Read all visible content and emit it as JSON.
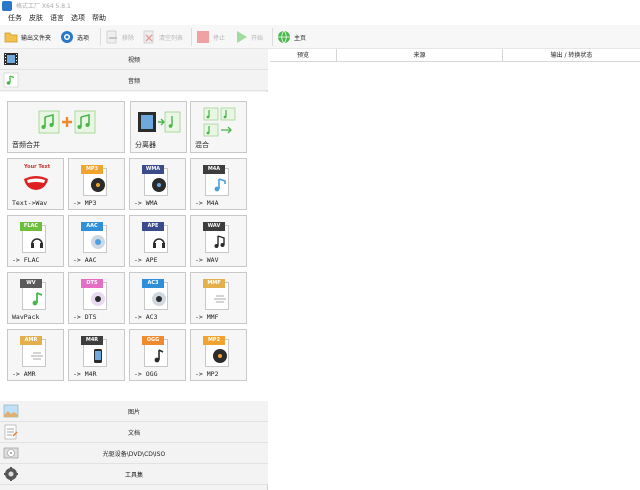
{
  "window": {
    "title": "格式工厂 X64 5.8.1"
  },
  "menu": {
    "items": [
      "任务",
      "皮肤",
      "语言",
      "选项",
      "帮助"
    ]
  },
  "toolbar": {
    "output_folder": "输出文件夹",
    "options": "选项",
    "remove": "移除",
    "clear_list": "清空列表",
    "stop": "停止",
    "start": "开始",
    "home": "主页"
  },
  "categories": {
    "video": "视频",
    "audio": "音频",
    "image": "图片",
    "document": "文档",
    "rom_device": "光驱设备\\DVD\\CD\\ISO",
    "toolbox": "工具集"
  },
  "audio_tools": [
    {
      "label": "音频合并",
      "format": "",
      "icon": "audio-merge-icon"
    },
    {
      "label": "分离器",
      "format": "",
      "icon": "audio-splitter-icon"
    },
    {
      "label": "混合",
      "format": "",
      "icon": "audio-mix-icon"
    },
    {
      "label": "Text->Wav",
      "format": "",
      "icon": "text-to-wav-icon"
    },
    {
      "label": "-> MP3",
      "format": "MP3",
      "icon": "mp3-icon",
      "color": "#f0a32e"
    },
    {
      "label": "-> WMA",
      "format": "WMA",
      "icon": "wma-icon",
      "color": "#3a4a8a"
    },
    {
      "label": "-> M4A",
      "format": "M4A",
      "icon": "m4a-icon",
      "color": "#3d3d3d"
    },
    {
      "label": "-> FLAC",
      "format": "FLAC",
      "icon": "flac-icon",
      "color": "#6fbd3d"
    },
    {
      "label": "-> AAC",
      "format": "AAC",
      "icon": "aac-icon",
      "color": "#2f8fd8"
    },
    {
      "label": "-> APE",
      "format": "APE",
      "icon": "ape-icon",
      "color": "#3a4a8a"
    },
    {
      "label": "-> WAV",
      "format": "WAV",
      "icon": "wav-icon",
      "color": "#3d3d3d"
    },
    {
      "label": "WavPack",
      "format": "WV",
      "icon": "wavpack-icon",
      "color": "#5a5a5a"
    },
    {
      "label": "-> DTS",
      "format": "DTS",
      "icon": "dts-icon",
      "color": "#e56dc4"
    },
    {
      "label": "-> AC3",
      "format": "AC3",
      "icon": "ac3-icon",
      "color": "#2f8fd8"
    },
    {
      "label": "-> MMF",
      "format": "MMF",
      "icon": "mmf-icon",
      "color": "#e3b04d"
    },
    {
      "label": "-> AMR",
      "format": "AMR",
      "icon": "amr-icon",
      "color": "#e3b04d"
    },
    {
      "label": "-> M4R",
      "format": "M4R",
      "icon": "m4r-icon",
      "color": "#3d3d3d"
    },
    {
      "label": "-> OGG",
      "format": "OGG",
      "icon": "ogg-icon",
      "color": "#f08a2e"
    },
    {
      "label": "-> MP2",
      "format": "MP2",
      "icon": "mp2-icon",
      "color": "#f0a32e"
    }
  ],
  "tool_logo_text": "Your Text",
  "task_table": {
    "columns": [
      "预览",
      "来源",
      "输出 / 转换状态"
    ]
  },
  "colors": {
    "accent_green": "#48b84a",
    "accent_blue": "#2c78c8",
    "stop_red": "#e06060"
  }
}
